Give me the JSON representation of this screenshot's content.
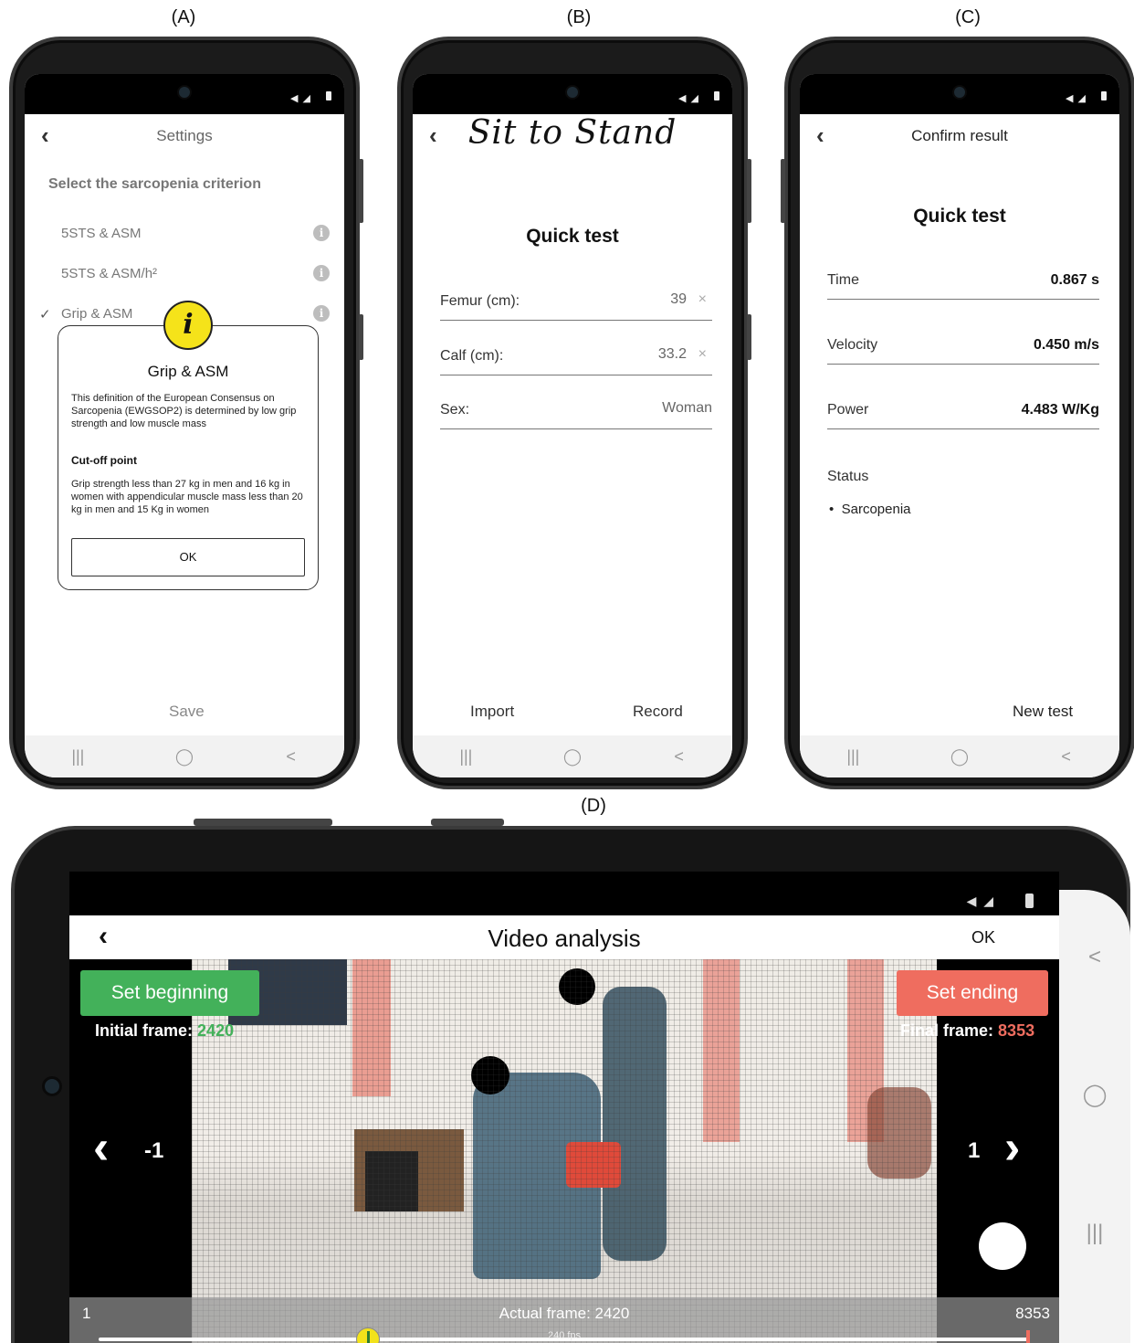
{
  "labels": {
    "a": "(A)",
    "b": "(B)",
    "c": "(C)",
    "d": "(D)"
  },
  "status_icons": "◀︎ ◢ ",
  "nav_icons": {
    "recents": "|||",
    "home": "◯",
    "back": "<"
  },
  "panel_a": {
    "title": "Settings",
    "heading": "Select the sarcopenia criterion",
    "criteria": [
      "5STS & ASM",
      "5STS & ASM/h²",
      "Grip & ASM"
    ],
    "selected_index": 2,
    "check": "✓",
    "info_icon": "i",
    "dialog": {
      "icon": "i",
      "title": "Grip & ASM",
      "text": "This definition of the European Consensus on Sarcopenia (EWGSOP2) is determined by low grip strength and low muscle mass",
      "subtitle": "Cut-off point",
      "text2": "Grip strength less than 27 kg in men and 16 kg in women with appendicular muscle mass less than 20 kg in men and 15 Kg in women",
      "ok": "OK"
    },
    "save": "Save"
  },
  "panel_b": {
    "app_title": "Sit to Stand",
    "title": "Quick test",
    "fields": [
      {
        "label": "Femur (cm):",
        "value": "39"
      },
      {
        "label": "Calf (cm):",
        "value": "33.2"
      },
      {
        "label": "Sex:",
        "value": "Woman"
      }
    ],
    "clear": "×",
    "import": "Import",
    "record": "Record"
  },
  "panel_c": {
    "title": "Confirm result",
    "subtitle": "Quick test",
    "rows": [
      {
        "label": "Time",
        "value": "0.867 s"
      },
      {
        "label": "Velocity",
        "value": "0.450 m/s"
      },
      {
        "label": "Power",
        "value": "4.483 W/Kg"
      }
    ],
    "status_label": "Status",
    "status_value": "Sarcopenia",
    "bullet": "•",
    "new_test": "New test"
  },
  "panel_d": {
    "title": "Video analysis",
    "ok": "OK",
    "set_beginning": "Set beginning",
    "set_ending": "Set ending",
    "initial_frame_label": "Initial frame:",
    "initial_frame": "2420",
    "final_frame_label": "Final frame:",
    "final_frame": "8353",
    "step_back": "-1",
    "step_forward": "1",
    "timeline_start": "1",
    "timeline_end": "8353",
    "actual_frame": "Actual frame: 2420",
    "fps": "240 fps",
    "slider_fraction": 0.29,
    "colors": {
      "begin": "#43b15a",
      "end": "#ef6d5f",
      "thumb": "#f2e21b"
    }
  }
}
